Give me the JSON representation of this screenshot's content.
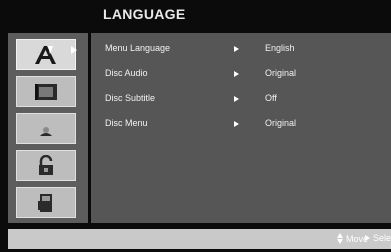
{
  "menu": {
    "title": "LANGUAGE"
  },
  "sidebar": {
    "tabs": [
      {
        "icon": "language-icon",
        "active": true
      },
      {
        "icon": "display-icon",
        "active": false
      },
      {
        "icon": "audio-icon",
        "active": false
      },
      {
        "icon": "lock-icon",
        "active": false
      },
      {
        "icon": "others-icon",
        "active": false
      }
    ]
  },
  "settings": [
    {
      "label": "Menu Language",
      "value": "English"
    },
    {
      "label": "Disc Audio",
      "value": "Original"
    },
    {
      "label": "Disc Subtitle",
      "value": "Off"
    },
    {
      "label": "Disc Menu",
      "value": "Original"
    }
  ],
  "footer": {
    "move_label": "Move",
    "select_label": "Select"
  },
  "colors": {
    "background": "#0b0b0b",
    "panel": "#565656",
    "sidebar": "#5d5d5d",
    "tab": "#bdbdbd",
    "footer": "#c9c9c9",
    "text": "#f2f2f2"
  }
}
